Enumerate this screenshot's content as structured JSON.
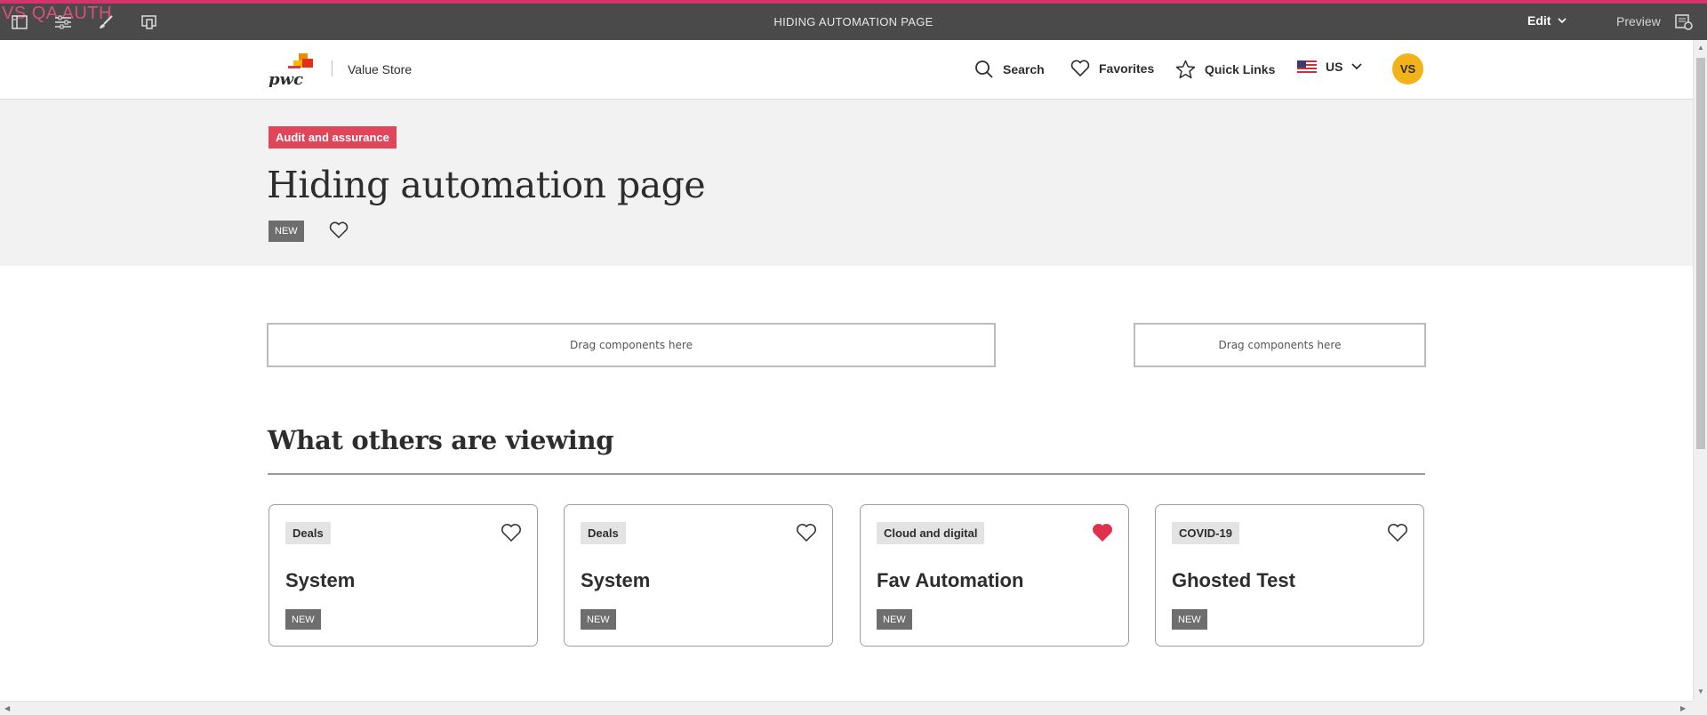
{
  "editor": {
    "watermark": "VS QA AUTH",
    "page_title": "HIDING AUTOMATION PAGE",
    "edit_label": "Edit",
    "preview_label": "Preview",
    "tools": [
      "side-panel-icon",
      "properties-icon",
      "style-brush-icon",
      "emulator-icon"
    ]
  },
  "header": {
    "logo_text": "pwc",
    "brand": "Value Store",
    "nav": {
      "search": "Search",
      "favorites": "Favorites",
      "quick_links": "Quick Links",
      "region": "US"
    },
    "avatar_initials": "VS"
  },
  "hero": {
    "category": "Audit and assurance",
    "title": "Hiding automation page",
    "badge": "NEW"
  },
  "dropzones": [
    "Drag components here",
    "Drag components here"
  ],
  "section": {
    "title": "What others are viewing"
  },
  "cards": [
    {
      "tag": "Deals",
      "title": "System",
      "badge": "NEW",
      "favorited": false
    },
    {
      "tag": "Deals",
      "title": "System",
      "badge": "NEW",
      "favorited": false
    },
    {
      "tag": "Cloud and digital",
      "title": "Fav Automation",
      "badge": "NEW",
      "favorited": true
    },
    {
      "tag": "COVID-19",
      "title": "Ghosted Test",
      "badge": "NEW",
      "favorited": false
    }
  ],
  "colors": {
    "editor_bar": "#4a4a4a",
    "accent_pink": "#e0465a",
    "favorite_red": "#e0304e",
    "avatar_yellow": "#f2b21a",
    "badge_gray": "#6e6e6e"
  }
}
